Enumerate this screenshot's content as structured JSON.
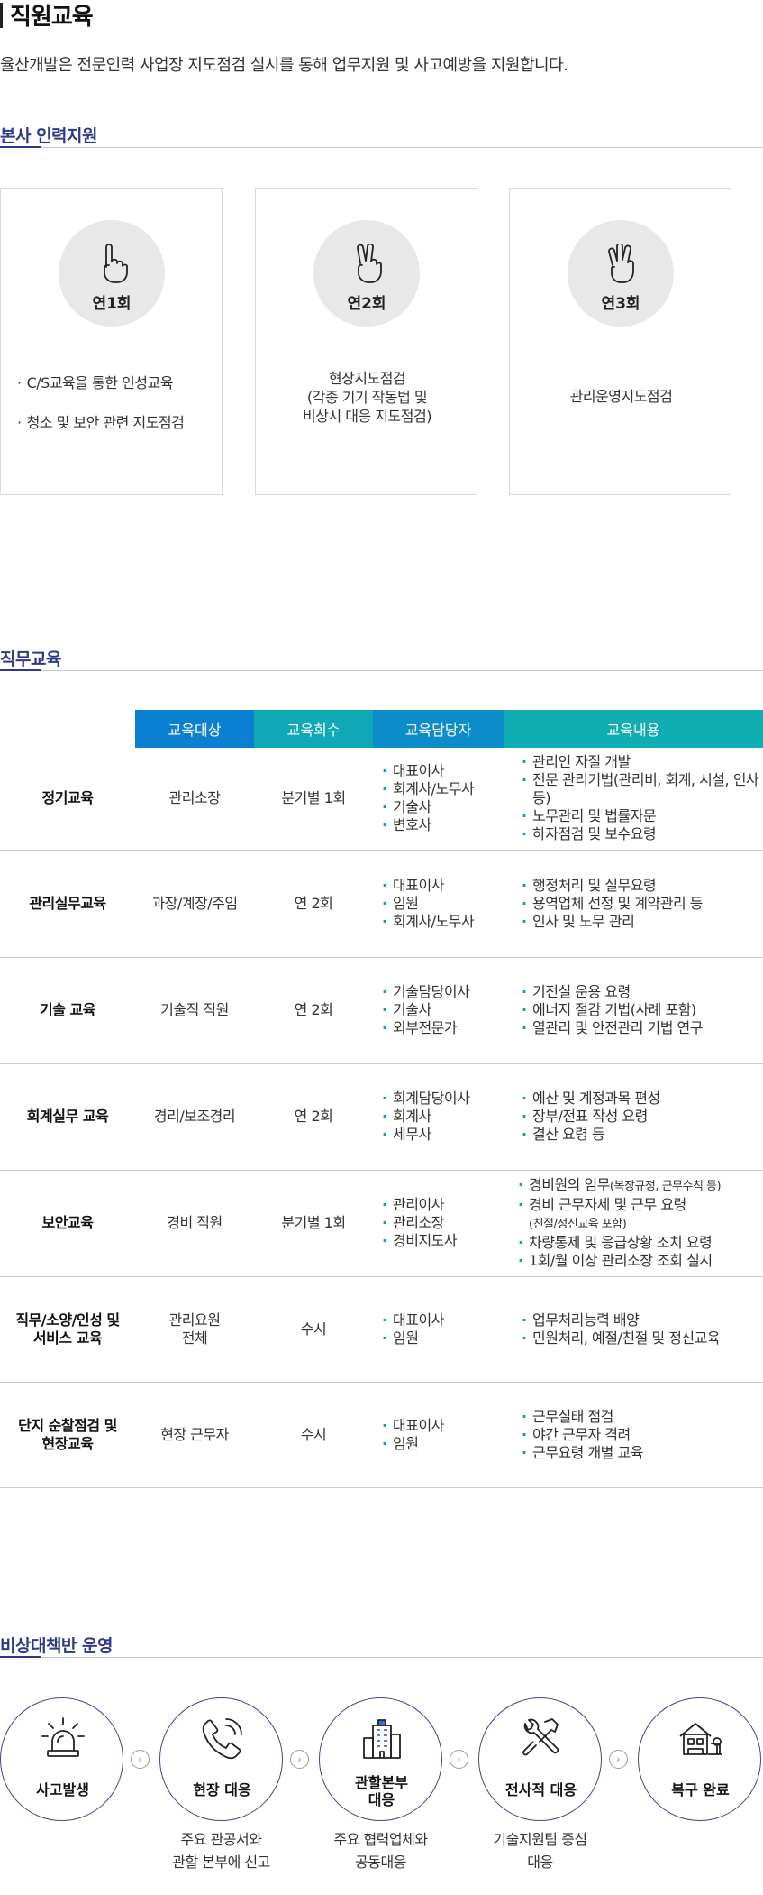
{
  "page": {
    "title": "직원교육",
    "intro": "율산개발은 전문인력 사업장 지도점검 실시를 통해 업무지원 및 사고예방을 지원합니다."
  },
  "support_section": {
    "title": "본사 인력지원",
    "cards": [
      {
        "frequency": "연1회",
        "hand_icon": "one-finger-hand-icon",
        "items": [
          "C/S교육을 통한 인성교육",
          "청소 및 보안 관련 지도점검"
        ]
      },
      {
        "frequency": "연2회",
        "hand_icon": "two-finger-hand-icon",
        "lines": [
          "현장지도점검",
          "(각종 기기 작동법 및",
          "비상시 대응 지도점검)"
        ]
      },
      {
        "frequency": "연3회",
        "hand_icon": "three-finger-hand-icon",
        "lines": [
          "관리운영지도점검"
        ]
      }
    ]
  },
  "job_section": {
    "title": "직무교육",
    "headers": [
      "교육대상",
      "교육회수",
      "교육담당자",
      "교육내용"
    ],
    "rows": [
      {
        "name": [
          "정기교육"
        ],
        "target": [
          "관리소장"
        ],
        "count": "분기별 1회",
        "staff": [
          "대표이사",
          "회계사/노무사",
          "기술사",
          "변호사"
        ],
        "content": [
          "관리인 자질 개발",
          "전문 관리기법(관리비, 회계, 시설, 인사 등)",
          "노무관리 및 법률자문",
          "하자점검 및 보수요령"
        ]
      },
      {
        "name": [
          "관리실무교육"
        ],
        "target": [
          "과장/계장/주임"
        ],
        "count": "연 2회",
        "staff": [
          "대표이사",
          "임원",
          "회계사/노무사"
        ],
        "content": [
          "행정처리 및 실무요령",
          "용역업체 선정 및 계약관리 등",
          "인사 및 노무 관리"
        ]
      },
      {
        "name": [
          "기술 교육"
        ],
        "target": [
          "기술직 직원"
        ],
        "count": "연 2회",
        "staff": [
          "기술담당이사",
          "기술사",
          "외부전문가"
        ],
        "content": [
          "기전실 운용 요령",
          "에너지 절감 기법(사례 포함)",
          "열관리 및 안전관리 기법 연구"
        ]
      },
      {
        "name": [
          "회계실무 교육"
        ],
        "target": [
          "경리/보조경리"
        ],
        "count": "연 2회",
        "staff": [
          "회계담당이사",
          "회계사",
          "세무사"
        ],
        "content": [
          "예산 및 계정과목 편성",
          "장부/전표 작성 요령",
          "결산 요령 등"
        ]
      },
      {
        "name": [
          "보안교육"
        ],
        "target": [
          "경비 직원"
        ],
        "count": "분기별 1회",
        "staff": [
          "관리이사",
          "관리소장",
          "경비지도사"
        ],
        "content_main": "경비원의 임무",
        "content_note": "(복장규정, 근무수칙 등)",
        "content_second": "경비 근무자세 및 근무 요령",
        "content_second_note": "(친절/정신교육 포함)",
        "content_rest": [
          "차량통제 및 응급상황 조치 요령",
          "1회/월 이상 관리소장 조회 실시"
        ]
      },
      {
        "name": [
          "직무/소양/인성 및",
          "서비스 교육"
        ],
        "target": [
          "관리요원",
          "전체"
        ],
        "count": "수시",
        "staff": [
          "대표이사",
          "임원"
        ],
        "content": [
          "업무처리능력 배양",
          "민원처리, 예절/친절 및 정신교육"
        ]
      },
      {
        "name": [
          "단지 순찰점검 및",
          "현장교육"
        ],
        "target": [
          "현장 근무자"
        ],
        "count": "수시",
        "staff": [
          "대표이사",
          "임원"
        ],
        "content": [
          "근무실태 점검",
          "야간 근무자 격려",
          "근무요령 개별 교육"
        ]
      }
    ]
  },
  "emergency_section": {
    "title": "비상대책반 운영",
    "steps": [
      {
        "label": [
          "사고발생"
        ],
        "icon": "siren-icon",
        "sub": []
      },
      {
        "label": [
          "현장 대응"
        ],
        "icon": "phone-icon",
        "sub": [
          "주요 관공서와",
          "관할 본부에 신고"
        ]
      },
      {
        "label": [
          "관할본부",
          "대응"
        ],
        "icon": "building-icon",
        "sub": [
          "주요 협력업체와",
          "공동대응"
        ]
      },
      {
        "label": [
          "전사적 대응"
        ],
        "icon": "tools-icon",
        "sub": [
          "기술지원팀 중심",
          "대응"
        ]
      },
      {
        "label": [
          "복구 완료"
        ],
        "icon": "house-icon",
        "sub": []
      }
    ]
  }
}
